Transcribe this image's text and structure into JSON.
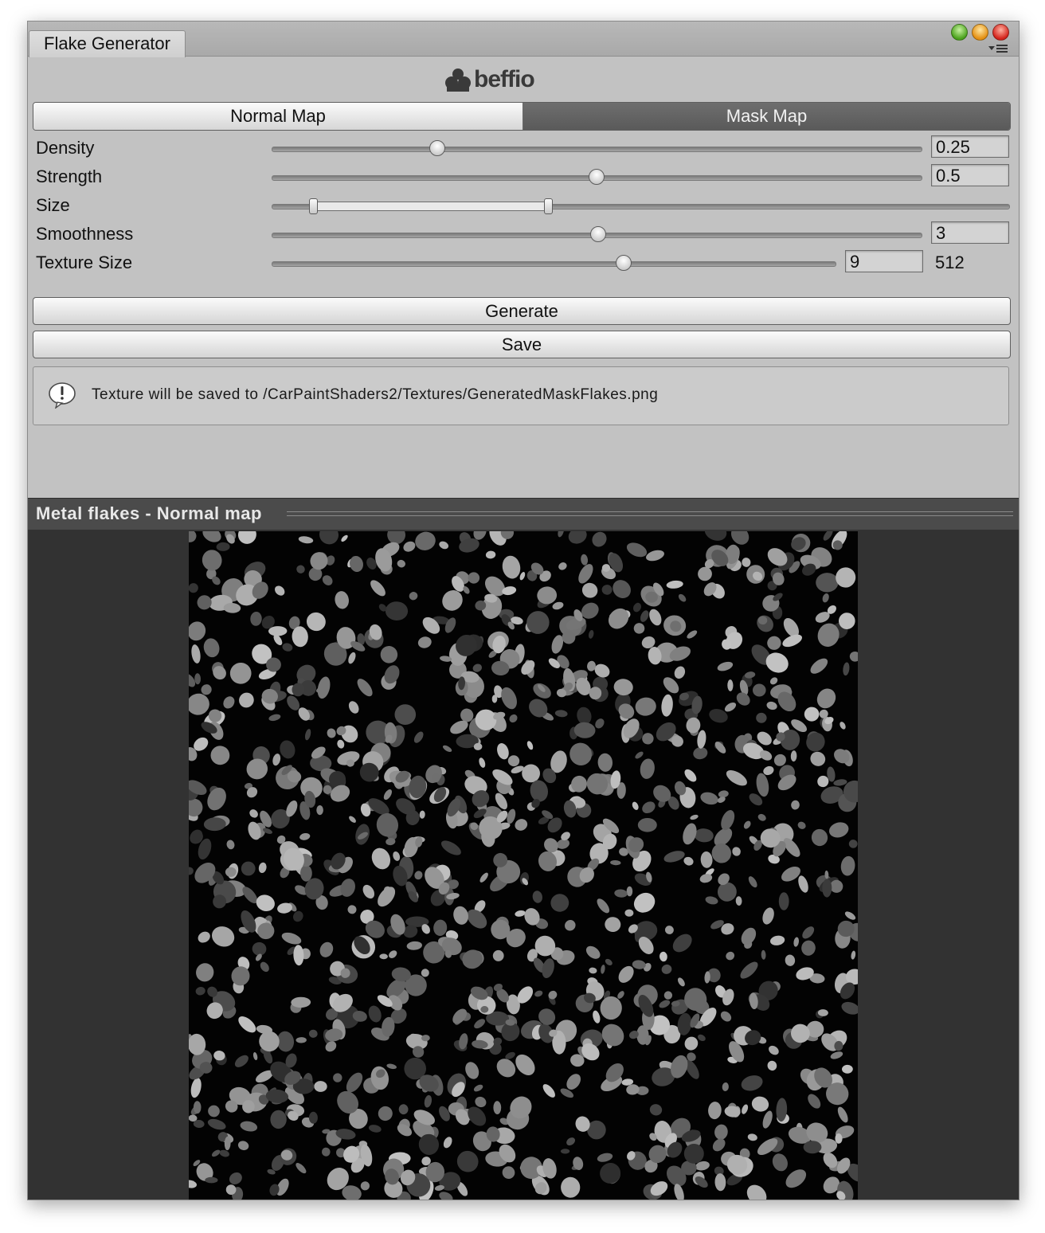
{
  "window": {
    "tab_title": "Flake Generator",
    "controls": [
      "close-button",
      "minimize-button",
      "zoom-button"
    ]
  },
  "logo": {
    "text": "beffio"
  },
  "toolbar": {
    "tabs": [
      {
        "label": "Normal Map",
        "selected": false
      },
      {
        "label": "Mask Map",
        "selected": true
      }
    ]
  },
  "settings": {
    "density": {
      "label": "Density",
      "value": "0.25",
      "fraction": 0.25
    },
    "strength": {
      "label": "Strength",
      "value": "0.5",
      "fraction": 0.5
    },
    "size": {
      "label": "Size",
      "range_min_fraction": 0.057,
      "range_max_fraction": 0.378
    },
    "smoothness": {
      "label": "Smoothness",
      "value": "3",
      "fraction": 0.5
    },
    "texture_size": {
      "label": "Texture Size",
      "value": "9",
      "fraction": 0.62,
      "resolution": "512"
    }
  },
  "buttons": {
    "generate_label": "Generate",
    "save_label": "Save"
  },
  "help": {
    "message": "Texture will be saved to /CarPaintShaders2/Textures/GeneratedMaskFlakes.png"
  },
  "preview": {
    "title": "Metal flakes - Normal map"
  },
  "colors": {
    "window_bg": "#c2c2c2",
    "preview_bg": "#323232",
    "mask_tab_bg": "#636363"
  }
}
